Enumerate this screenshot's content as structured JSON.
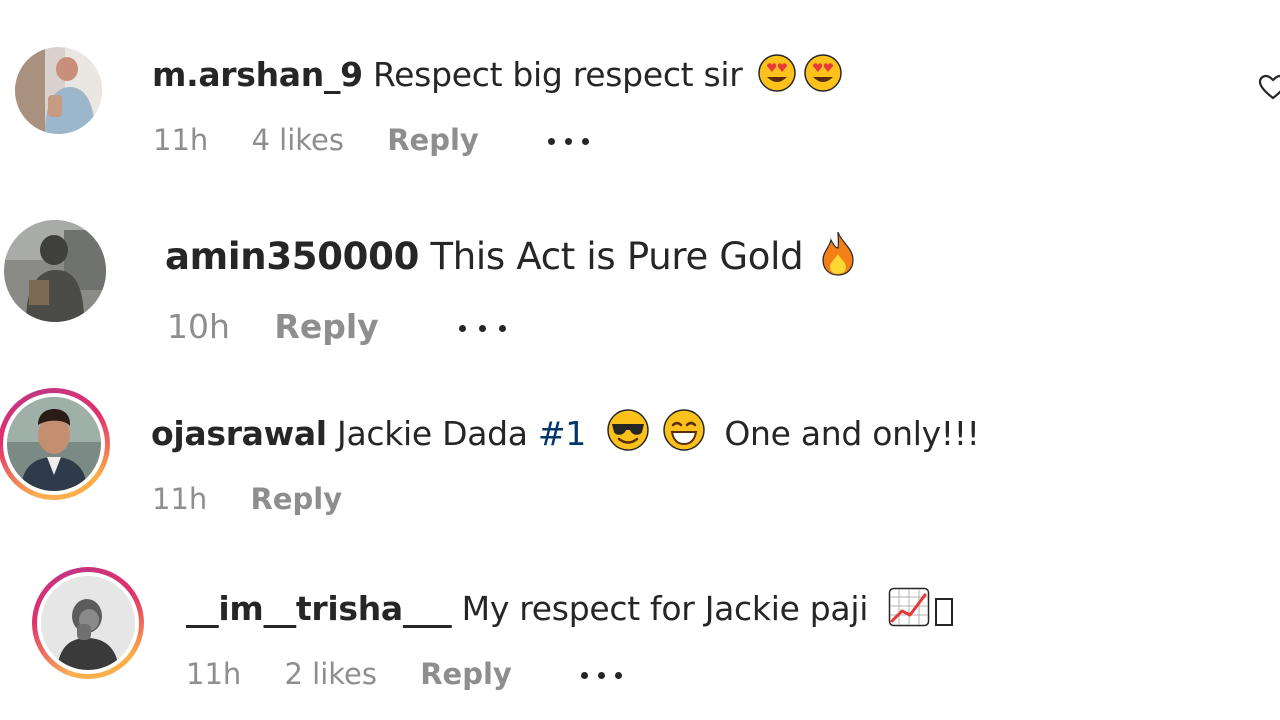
{
  "comments": [
    {
      "username": "m.arshan_9",
      "text": "Respect big respect sir",
      "emoji": [
        "heart-eyes-emoji",
        "heart-eyes-emoji"
      ],
      "time": "11h",
      "likes": "4 likes",
      "reply": "Reply"
    },
    {
      "username": "amin350000",
      "text": "This Act is Pure Gold",
      "emoji": [
        "fire-emoji"
      ],
      "time": "10h",
      "reply": "Reply"
    },
    {
      "username": "ojasrawal",
      "text_before": "Jackie Dada",
      "hashtag": "#1",
      "text_after": "One and only!!!",
      "emoji": [
        "sunglasses-emoji",
        "grinning-emoji"
      ],
      "time": "11h",
      "reply": "Reply"
    },
    {
      "username": "__im__trisha___",
      "text": "My respect for Jackie paji",
      "emoji": [
        "chart-increasing-emoji",
        "missing-glyph"
      ],
      "time": "11h",
      "likes": "2 likes",
      "reply": "Reply"
    }
  ],
  "colors": {
    "text": "#262626",
    "meta": "#8e8e8e",
    "hashtag": "#00376b",
    "story_ring": [
      "#fbad50",
      "#e1306c",
      "#c13584"
    ]
  }
}
